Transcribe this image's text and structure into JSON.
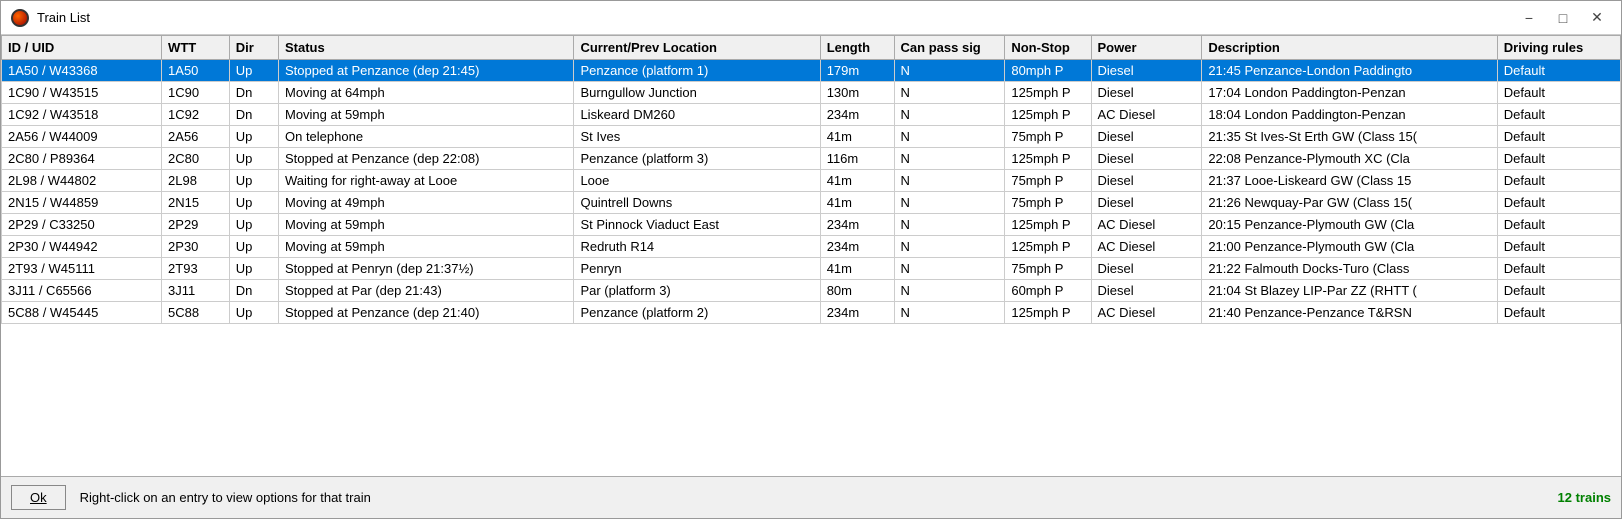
{
  "window": {
    "title": "Train List",
    "icon": "train-icon"
  },
  "titlebar": {
    "minimize_label": "−",
    "maximize_label": "□",
    "close_label": "✕"
  },
  "table": {
    "columns": [
      {
        "key": "id",
        "label": "ID / UID",
        "class": "col-id"
      },
      {
        "key": "wtt",
        "label": "WTT",
        "class": "col-wtt"
      },
      {
        "key": "dir",
        "label": "Dir",
        "class": "col-dir"
      },
      {
        "key": "status",
        "label": "Status",
        "class": "col-status"
      },
      {
        "key": "location",
        "label": "Current/Prev Location",
        "class": "col-location"
      },
      {
        "key": "length",
        "label": "Length",
        "class": "col-length"
      },
      {
        "key": "canpass",
        "label": "Can pass sig",
        "class": "col-canpass"
      },
      {
        "key": "nonstop",
        "label": "Non-Stop",
        "class": "col-nonstop"
      },
      {
        "key": "power",
        "label": "Power",
        "class": "col-power"
      },
      {
        "key": "desc",
        "label": "Description",
        "class": "col-desc"
      },
      {
        "key": "driving",
        "label": "Driving rules",
        "class": "col-driving"
      }
    ],
    "rows": [
      {
        "id": "1A50 / W43368",
        "wtt": "1A50",
        "dir": "Up",
        "status": "Stopped at Penzance (dep 21:45)",
        "location": "Penzance (platform 1)",
        "length": "179m",
        "canpass": "N",
        "nonstop": "80mph P",
        "power": "Diesel",
        "desc": "21:45   Penzance-London Paddingto",
        "driving": "Default",
        "selected": true
      },
      {
        "id": "1C90 / W43515",
        "wtt": "1C90",
        "dir": "Dn",
        "status": "Moving at 64mph",
        "location": "Burngullow Junction",
        "length": "130m",
        "canpass": "N",
        "nonstop": "125mph P",
        "power": "Diesel",
        "desc": "17:04   London Paddington-Penzan",
        "driving": "Default",
        "selected": false
      },
      {
        "id": "1C92 / W43518",
        "wtt": "1C92",
        "dir": "Dn",
        "status": "Moving at 59mph",
        "location": "Liskeard DM260",
        "length": "234m",
        "canpass": "N",
        "nonstop": "125mph P",
        "power": "AC Diesel",
        "desc": "18:04   London Paddington-Penzan",
        "driving": "Default",
        "selected": false
      },
      {
        "id": "2A56 / W44009",
        "wtt": "2A56",
        "dir": "Up",
        "status": "On telephone",
        "location": "St Ives",
        "length": "41m",
        "canpass": "N",
        "nonstop": "75mph P",
        "power": "Diesel",
        "desc": "21:35   St Ives-St Erth GW (Class 15(",
        "driving": "Default",
        "selected": false
      },
      {
        "id": "2C80 / P89364",
        "wtt": "2C80",
        "dir": "Up",
        "status": "Stopped at Penzance (dep 22:08)",
        "location": "Penzance (platform 3)",
        "length": "116m",
        "canpass": "N",
        "nonstop": "125mph P",
        "power": "Diesel",
        "desc": "22:08   Penzance-Plymouth XC (Cla",
        "driving": "Default",
        "selected": false
      },
      {
        "id": "2L98 / W44802",
        "wtt": "2L98",
        "dir": "Up",
        "status": "Waiting for right-away at Looe",
        "location": "Looe",
        "length": "41m",
        "canpass": "N",
        "nonstop": "75mph P",
        "power": "Diesel",
        "desc": "21:37   Looe-Liskeard GW (Class 15",
        "driving": "Default",
        "selected": false
      },
      {
        "id": "2N15 / W44859",
        "wtt": "2N15",
        "dir": "Up",
        "status": "Moving at 49mph",
        "location": "Quintrell Downs",
        "length": "41m",
        "canpass": "N",
        "nonstop": "75mph P",
        "power": "Diesel",
        "desc": "21:26   Newquay-Par GW (Class 15(",
        "driving": "Default",
        "selected": false
      },
      {
        "id": "2P29 / C33250",
        "wtt": "2P29",
        "dir": "Up",
        "status": "Moving at 59mph",
        "location": "St Pinnock Viaduct East",
        "length": "234m",
        "canpass": "N",
        "nonstop": "125mph P",
        "power": "AC Diesel",
        "desc": "20:15   Penzance-Plymouth GW (Cla",
        "driving": "Default",
        "selected": false
      },
      {
        "id": "2P30 / W44942",
        "wtt": "2P30",
        "dir": "Up",
        "status": "Moving at 59mph",
        "location": "Redruth R14",
        "length": "234m",
        "canpass": "N",
        "nonstop": "125mph P",
        "power": "AC Diesel",
        "desc": "21:00   Penzance-Plymouth GW (Cla",
        "driving": "Default",
        "selected": false
      },
      {
        "id": "2T93 / W45111",
        "wtt": "2T93",
        "dir": "Up",
        "status": "Stopped at Penryn (dep 21:37½)",
        "location": "Penryn",
        "length": "41m",
        "canpass": "N",
        "nonstop": "75mph P",
        "power": "Diesel",
        "desc": "21:22   Falmouth Docks-Turo  (Class",
        "driving": "Default",
        "selected": false
      },
      {
        "id": "3J11 / C65566",
        "wtt": "3J11",
        "dir": "Dn",
        "status": "Stopped at Par (dep 21:43)",
        "location": "Par (platform 3)",
        "length": "80m",
        "canpass": "N",
        "nonstop": "60mph P",
        "power": "Diesel",
        "desc": "21:04   St Blazey LIP-Par ZZ (RHTT (",
        "driving": "Default",
        "selected": false
      },
      {
        "id": "5C88 / W45445",
        "wtt": "5C88",
        "dir": "Up",
        "status": "Stopped at Penzance (dep 21:40)",
        "location": "Penzance (platform 2)",
        "length": "234m",
        "canpass": "N",
        "nonstop": "125mph P",
        "power": "AC Diesel",
        "desc": "21:40   Penzance-Penzance T&RSN",
        "driving": "Default",
        "selected": false
      }
    ]
  },
  "footer": {
    "ok_label": "Ok",
    "hint": "Right-click on an entry to view options for that train",
    "train_count": "12 trains"
  }
}
